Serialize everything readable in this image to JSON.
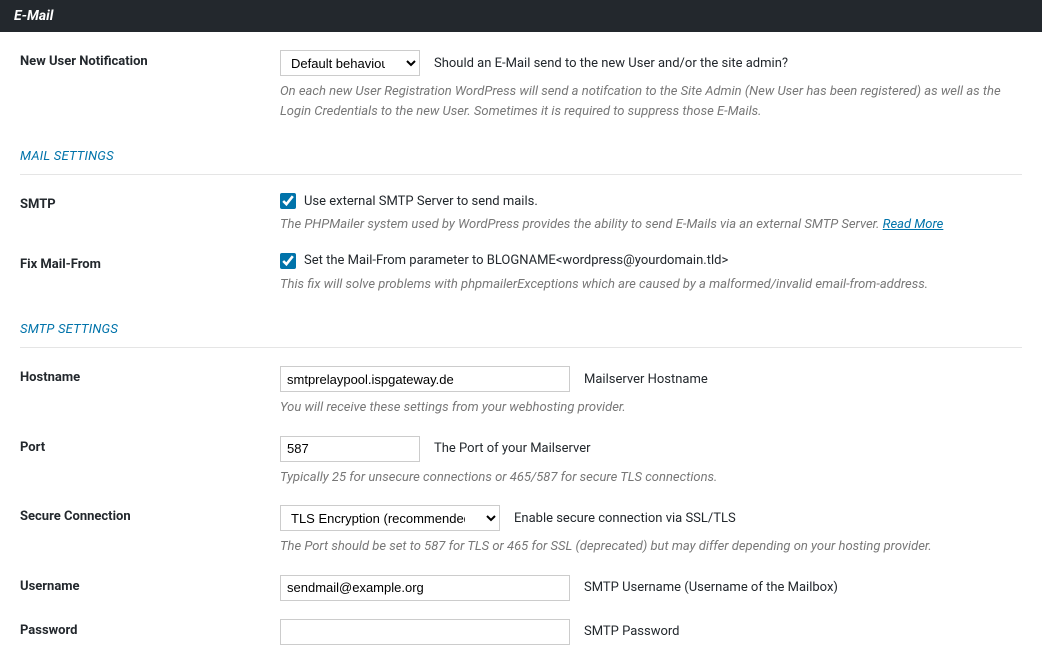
{
  "header": {
    "title": "E-Mail"
  },
  "newUserNotif": {
    "label": "New User Notification",
    "selected": "Default behaviour",
    "hint": "Should an E-Mail send to the new User and/or the site admin?",
    "desc": "On each new User Registration WordPress will send a notifcation to the Site Admin (New User has been registered) as well as the Login Credentials to the new User. Sometimes it is required to suppress those E-Mails."
  },
  "sections": {
    "mail": "MAIL SETTINGS",
    "smtp": "SMTP SETTINGS"
  },
  "smtp": {
    "label": "SMTP",
    "cbLabel": "Use external SMTP Server to send mails.",
    "desc": "The PHPMailer system used by WordPress provides the ability to send E-Mails via an external SMTP Server. ",
    "readMore": "Read More"
  },
  "fixFrom": {
    "label": "Fix Mail-From",
    "cbLabel": "Set the Mail-From parameter to BLOGNAME<wordpress@yourdomain.tld>",
    "desc": "This fix will solve problems with phpmailerExceptions which are caused by a malformed/invalid email-from-address."
  },
  "hostname": {
    "label": "Hostname",
    "value": "smtprelaypool.ispgateway.de",
    "hint": "Mailserver Hostname",
    "desc": "You will receive these settings from your webhosting provider."
  },
  "port": {
    "label": "Port",
    "value": "587",
    "hint": "The Port of your Mailserver",
    "desc": "Typically 25 for unsecure connections or 465/587 for secure TLS connections."
  },
  "secure": {
    "label": "Secure Connection",
    "selected": "TLS Encryption (recommended)",
    "hint": "Enable secure connection via SSL/TLS",
    "desc": "The Port should be set to 587 for TLS or 465 for SSL (deprecated) but may differ depending on your hosting provider."
  },
  "username": {
    "label": "Username",
    "value": "sendmail@example.org",
    "hint": "SMTP Username (Username of the Mailbox)"
  },
  "password": {
    "label": "Password",
    "value": "",
    "hint": "SMTP Password"
  }
}
